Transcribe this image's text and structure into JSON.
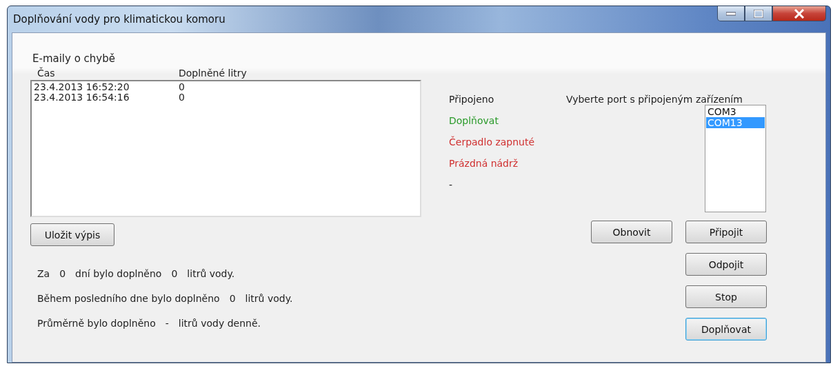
{
  "window": {
    "title": "Doplňování vody pro klimatickou komoru"
  },
  "email_log": {
    "title": "E-maily o chybě",
    "columns": [
      "Čas",
      "Doplněné litry"
    ],
    "rows": [
      [
        "23.4.2013 16:52:20",
        "0"
      ],
      [
        "23.4.2013 16:54:16",
        "0"
      ]
    ]
  },
  "save_button": "Uložit výpis",
  "stats": [
    [
      "Za",
      "0",
      "dní bylo doplněno",
      "0",
      "litrů vody."
    ],
    [
      "Během posledního dne bylo doplněno",
      "0",
      "litrů vody."
    ],
    [
      "Průměrně bylo doplněno",
      "-",
      "litrů vody denně."
    ]
  ],
  "status": [
    {
      "text": "Připojeno",
      "color": "#202020"
    },
    {
      "text": "Doplňovat",
      "color": "#2a9a2a"
    },
    {
      "text": "Čerpadlo zapnuté",
      "color": "#d03030"
    },
    {
      "text": "Prázdná nádrž",
      "color": "#d03030"
    },
    {
      "text": "-",
      "color": "#202020"
    }
  ],
  "port_label": "Vyberte port  s připojeným zařízením",
  "ports": [
    {
      "label": "COM3",
      "selected": false
    },
    {
      "label": "COM13",
      "selected": true
    }
  ],
  "buttons": [
    {
      "label": "Obnovit",
      "focused": false
    },
    {
      "label": "Připojit",
      "focused": false
    },
    {
      "label": "Odpojit",
      "focused": false
    },
    {
      "label": "Stop",
      "focused": false
    },
    {
      "label": "Doplňovat",
      "focused": true
    }
  ]
}
